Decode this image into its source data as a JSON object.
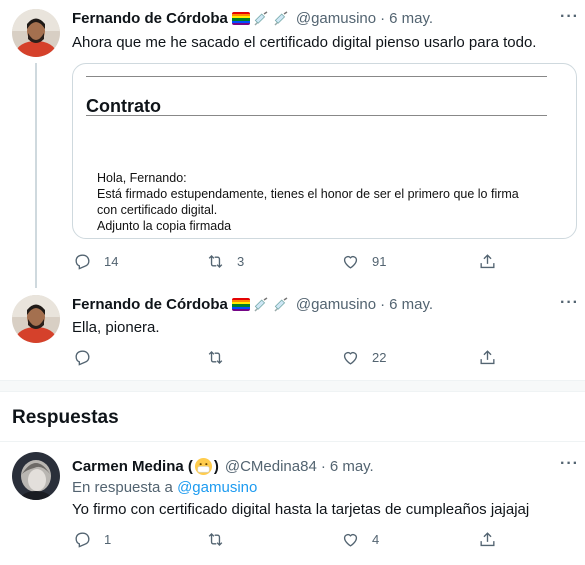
{
  "tweet1": {
    "name": "Fernando de Córdoba",
    "handle": "@gamusino",
    "dot": "·",
    "date": "6 may.",
    "text": "Ahora que me he sacado el certificado digital pienso usarlo para todo.",
    "embed": {
      "title": "Contrato",
      "lines": [
        "Hola, Fernando:",
        "Está firmado estupendamente, tienes el honor de ser el primero que lo firma",
        "con certificado digital.",
        "Adjunto la copia firmada"
      ]
    },
    "replies": "14",
    "retweets": "3",
    "likes": "91"
  },
  "tweet2": {
    "name": "Fernando de Córdoba",
    "handle": "@gamusino",
    "dot": "·",
    "date": "6 may.",
    "text": "Ella, pionera.",
    "likes": "22"
  },
  "section": {
    "title": "Respuestas"
  },
  "reply": {
    "name": "Carmen Medina (",
    "name_close": ")",
    "handle": "@CMedina84",
    "dot": "·",
    "date": "6 may.",
    "in_reply_prefix": "En respuesta a",
    "in_reply_handle": "@gamusino",
    "text": "Yo firmo con certificado digital hasta la tarjetas de cumpleaños jajajaj",
    "replies": "1",
    "likes": "4"
  },
  "icons": {
    "flag": "rainbow-flag-icon",
    "syringe": "syringe-icon",
    "mask": "face-with-mask-icon",
    "reply": "reply-icon",
    "retweet": "retweet-icon",
    "like": "heart-icon",
    "share": "share-icon",
    "more": "more-icon"
  },
  "colors": {
    "accent": "#1d9bf0",
    "muted": "#536471",
    "text": "#0f1419"
  }
}
